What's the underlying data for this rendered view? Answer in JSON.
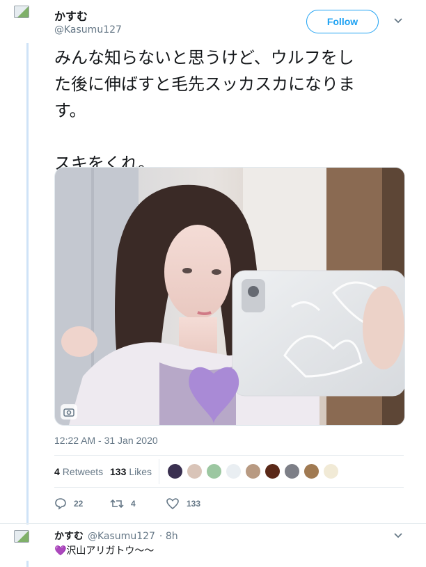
{
  "tweet": {
    "author_name": "かすむ",
    "author_handle": "@Kasumu127",
    "follow_label": "Follow",
    "text_lines": [
      "みんな知らないと思うけど、ウルフをし",
      "た後に伸ばすと毛先スッカスカになりま",
      "す。"
    ],
    "text_tail": "スキをくれ。",
    "timestamp": "12:22 AM - 31 Jan 2020",
    "retweets_count": "4",
    "retweets_label": "Retweets",
    "likes_count": "133",
    "likes_label": "Likes",
    "actions": {
      "reply_count": "22",
      "retweet_count": "4",
      "like_count": "133"
    },
    "photo_sticker": "heart"
  },
  "likers": [
    {
      "color": "#3a3050"
    },
    {
      "color": "#d9c4b8"
    },
    {
      "color": "#9cc7a1"
    },
    {
      "color": "#e9eef2"
    },
    {
      "color": "#b89a82"
    },
    {
      "color": "#5a2818"
    },
    {
      "color": "#7d7f87"
    },
    {
      "color": "#a07a52"
    },
    {
      "color": "#f1ead6"
    }
  ],
  "reply": {
    "author_name": "かすむ",
    "author_handle": "@Kasumu127",
    "time": "· 8h",
    "text": "💜沢山アリガトウ〜〜"
  },
  "colors": {
    "accent": "#1da1f2",
    "heart_sticker": "#a98ad6"
  }
}
